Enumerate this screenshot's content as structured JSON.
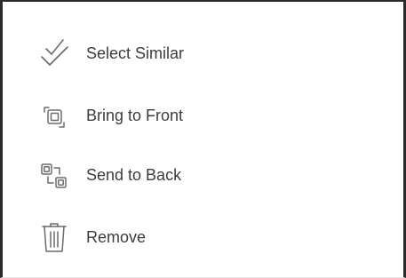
{
  "menu": {
    "items": [
      {
        "label": "Select Similar",
        "icon": "check-double-icon"
      },
      {
        "label": "Bring to Front",
        "icon": "bring-to-front-icon"
      },
      {
        "label": "Send to Back",
        "icon": "send-to-back-icon"
      },
      {
        "label": "Remove",
        "icon": "trash-icon"
      }
    ]
  },
  "colors": {
    "text": "#3c3c3c",
    "icon": "#6b6b6b",
    "border": "#2a2a2a"
  }
}
